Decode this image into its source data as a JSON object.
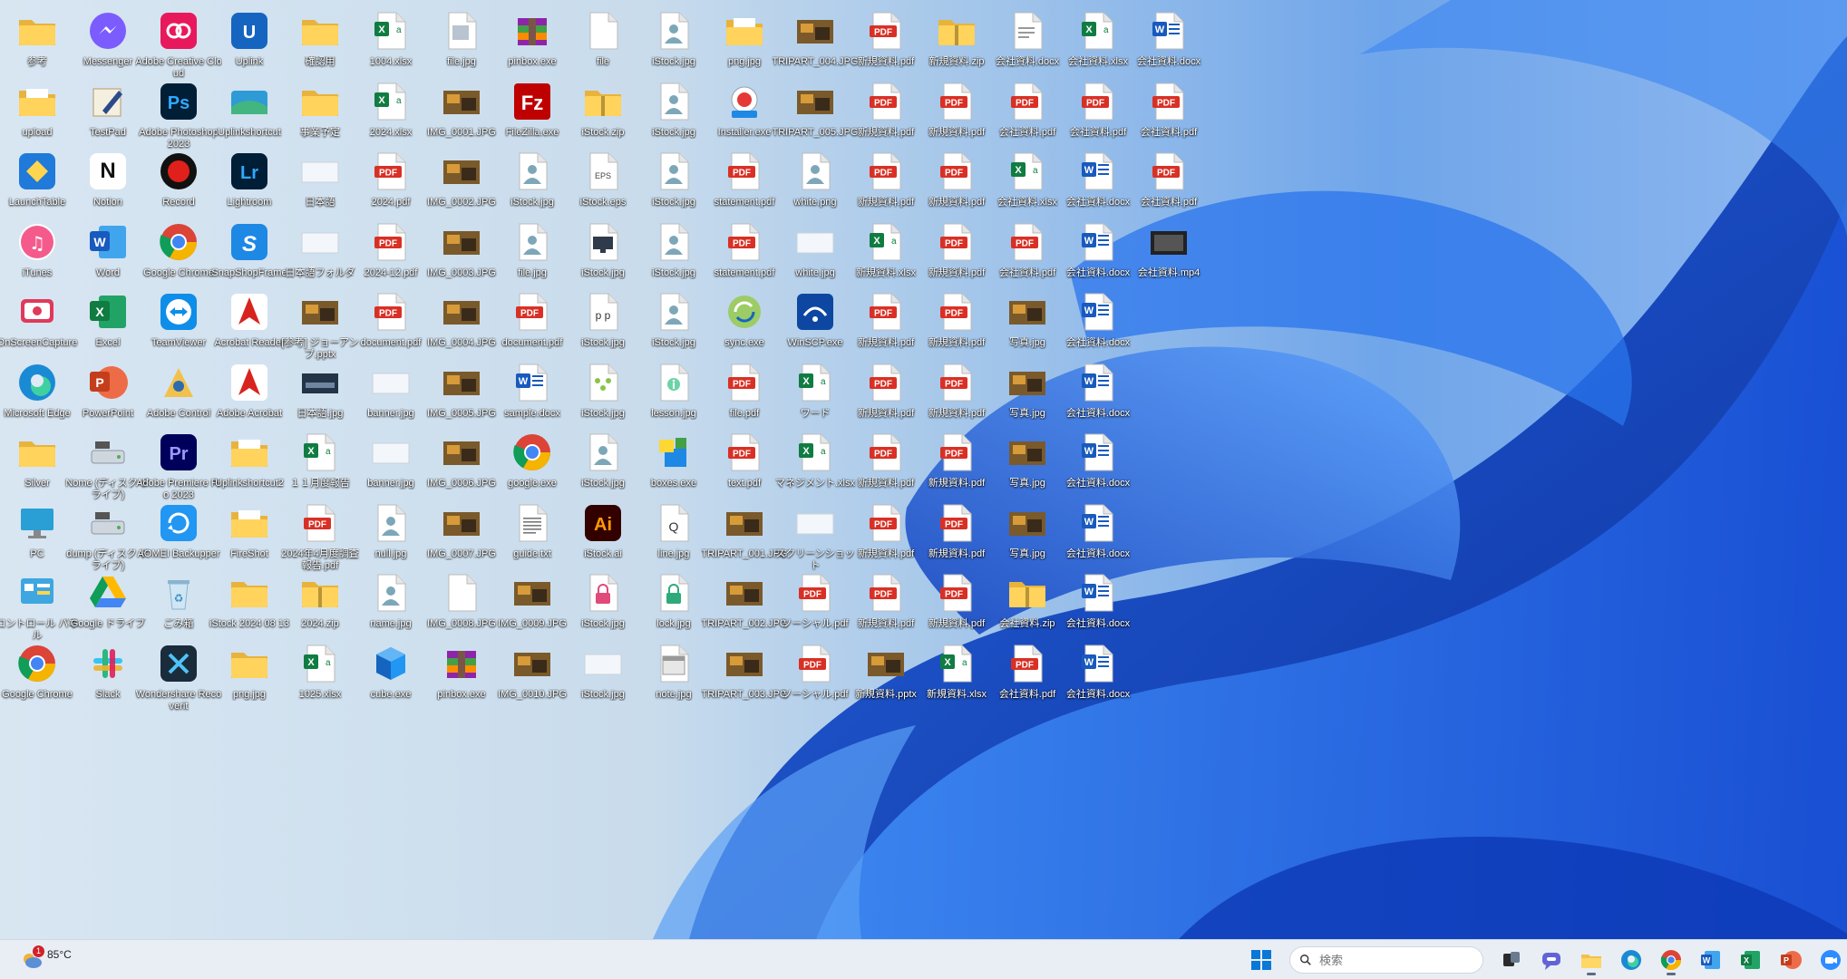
{
  "taskbar": {
    "weather": {
      "temp": "85°C",
      "condition": "",
      "badge": "1"
    },
    "search": {
      "placeholder": "検索",
      "value": ""
    },
    "apps": [
      {
        "name": "windows-start",
        "icon": "windows-icon"
      },
      {
        "name": "search-field",
        "icon": "search-icon"
      },
      {
        "name": "task-view",
        "icon": "task-view-icon"
      },
      {
        "name": "teams-chat",
        "icon": "chat-icon"
      },
      {
        "name": "file-explorer",
        "icon": "folder-icon",
        "running": true
      },
      {
        "name": "edge",
        "icon": "edge-icon"
      },
      {
        "name": "chrome",
        "icon": "chrome-icon",
        "running": true
      },
      {
        "name": "word",
        "icon": "word-icon"
      },
      {
        "name": "excel",
        "icon": "excel-icon"
      },
      {
        "name": "powerpoint",
        "icon": "powerpoint-icon"
      },
      {
        "name": "zoom",
        "icon": "zoom-icon"
      }
    ]
  },
  "desktop": {
    "columns": [
      [
        {
          "label": "参考",
          "icon": "folder"
        },
        {
          "label": "upload",
          "icon": "folder-doc"
        },
        {
          "label": "LaunchTable",
          "icon": "app-blue"
        },
        {
          "label": "iTunes",
          "icon": "itunes"
        },
        {
          "label": "OnScreenCapture",
          "icon": "app-red"
        },
        {
          "label": "Microsoft Edge",
          "icon": "edge"
        },
        {
          "label": "Silver",
          "icon": "folder"
        },
        {
          "label": "PC",
          "icon": "pc"
        },
        {
          "label": "コントロール パネル",
          "icon": "control-panel"
        },
        {
          "label": "Google Chrome",
          "icon": "chrome"
        }
      ],
      [
        {
          "label": "Messenger",
          "icon": "messenger"
        },
        {
          "label": "TestPad",
          "icon": "app-pen"
        },
        {
          "label": "Notion",
          "icon": "notion"
        },
        {
          "label": "Word",
          "icon": "word"
        },
        {
          "label": "Excel",
          "icon": "excel"
        },
        {
          "label": "PowerPoint",
          "icon": "powerpoint"
        },
        {
          "label": "Nome (ディスク ドライブ)",
          "icon": "drive"
        },
        {
          "label": "dump (ディスク ドライブ)",
          "icon": "drive"
        },
        {
          "label": "Google ドライブ",
          "icon": "gdrive"
        },
        {
          "label": "Slack",
          "icon": "slack"
        }
      ],
      [
        {
          "label": "Adobe Creative Cloud",
          "icon": "creative-cloud"
        },
        {
          "label": "Adobe Photoshop 2023",
          "icon": "photoshop"
        },
        {
          "label": "Record",
          "icon": "record"
        },
        {
          "label": "Google Chrome",
          "icon": "chrome"
        },
        {
          "label": "TeamViewer",
          "icon": "teamviewer"
        },
        {
          "label": "Adobe Control",
          "icon": "app-gold"
        },
        {
          "label": "Adobe Premiere Pro 2023",
          "icon": "premiere"
        },
        {
          "label": "AOMEI Backupper",
          "icon": "aomei"
        },
        {
          "label": "ごみ箱",
          "icon": "recycle"
        },
        {
          "label": "Wondershare Recoverit",
          "icon": "app-dark"
        }
      ],
      [
        {
          "label": "Uplink",
          "icon": "app-blue2"
        },
        {
          "label": "Uplinkshortcut",
          "icon": "app-green"
        },
        {
          "label": "Lightroom",
          "icon": "lightroom"
        },
        {
          "label": "SnapShopFrame",
          "icon": "app-s"
        },
        {
          "label": "Acrobat Reader",
          "icon": "acrobat"
        },
        {
          "label": "Adobe Acrobat",
          "icon": "acrobat"
        },
        {
          "label": "Uplinkshortcut2",
          "icon": "folder-doc"
        },
        {
          "label": "FireShot",
          "icon": "folder-doc"
        },
        {
          "label": "iStock 2024 08 13",
          "icon": "folder"
        },
        {
          "label": "png.jpg",
          "icon": "folder"
        }
      ],
      [
        {
          "label": "確認用",
          "icon": "folder"
        },
        {
          "label": "事業予定",
          "icon": "folder"
        },
        {
          "label": "日本語",
          "icon": "image-blank"
        },
        {
          "label": "日本語フォルダ",
          "icon": "image-blank"
        },
        {
          "label": "[参考] ジョーアンプ.pptx",
          "icon": "image-photo"
        },
        {
          "label": "日本語.jpg",
          "icon": "image-dark"
        },
        {
          "label": "１１月度報告",
          "icon": "excel-file"
        },
        {
          "label": "2024年4月度調査報告.pdf",
          "icon": "pdf"
        },
        {
          "label": "2024.zip",
          "icon": "zip"
        },
        {
          "label": "1025.xlsx",
          "icon": "excel-file"
        }
      ],
      [
        {
          "label": "1004.xlsx",
          "icon": "excel-file"
        },
        {
          "label": "2024.xlsx",
          "icon": "excel-file"
        },
        {
          "label": "2024.pdf",
          "icon": "pdf"
        },
        {
          "label": "2024-12.pdf",
          "icon": "pdf"
        },
        {
          "label": "document.pdf",
          "icon": "pdf"
        },
        {
          "label": "banner.jpg",
          "icon": "image-blank"
        },
        {
          "label": "banner.jpg",
          "icon": "image-blank"
        },
        {
          "label": "null.jpg",
          "icon": "person-file"
        },
        {
          "label": "name.jpg",
          "icon": "person-file"
        },
        {
          "label": "cube.exe",
          "icon": "cube"
        }
      ],
      [
        {
          "label": "file.jpg",
          "icon": "image-file"
        },
        {
          "label": "IMG_0001.JPG",
          "icon": "image-photo"
        },
        {
          "label": "IMG_0002.JPG",
          "icon": "image-photo"
        },
        {
          "label": "IMG_0003.JPG",
          "icon": "image-photo"
        },
        {
          "label": "IMG_0004.JPG",
          "icon": "image-photo"
        },
        {
          "label": "IMG_0005.JPG",
          "icon": "image-photo"
        },
        {
          "label": "IMG_0006.JPG",
          "icon": "image-photo"
        },
        {
          "label": "IMG_0007.JPG",
          "icon": "image-photo"
        },
        {
          "label": "IMG_0008.JPG",
          "icon": "generic-file"
        },
        {
          "label": "pinbox.exe",
          "icon": "winrar"
        }
      ],
      [
        {
          "label": "pinbox.exe",
          "icon": "winrar"
        },
        {
          "label": "FileZilla.exe",
          "icon": "filezilla"
        },
        {
          "label": "iStock.jpg",
          "icon": "person-file"
        },
        {
          "label": "file.jpg",
          "icon": "person-file"
        },
        {
          "label": "document.pdf",
          "icon": "pdf"
        },
        {
          "label": "sample.docx",
          "icon": "word-file"
        },
        {
          "label": "google.exe",
          "icon": "chrome"
        },
        {
          "label": "guide.txt",
          "icon": "text-file"
        },
        {
          "label": "IMG_0009.JPG",
          "icon": "image-photo"
        },
        {
          "label": "IMG_0010.JPG",
          "icon": "image-photo"
        }
      ],
      [
        {
          "label": "file",
          "icon": "generic-file"
        },
        {
          "label": "iStock.zip",
          "icon": "zip"
        },
        {
          "label": "iStock.eps",
          "icon": "eps"
        },
        {
          "label": "iStock.jpg",
          "icon": "monitor-file"
        },
        {
          "label": "iStock.jpg",
          "icon": "pp-file"
        },
        {
          "label": "iStock.jpg",
          "icon": "chart-file"
        },
        {
          "label": "iStock.jpg",
          "icon": "person-file"
        },
        {
          "label": "iStock.ai",
          "icon": "illustrator"
        },
        {
          "label": "iStock.jpg",
          "icon": "lock-pink"
        },
        {
          "label": "iStock.jpg",
          "icon": "image-blank"
        }
      ],
      [
        {
          "label": "iStock.jpg",
          "icon": "person-file"
        },
        {
          "label": "iStock.jpg",
          "icon": "person-file"
        },
        {
          "label": "iStock.jpg",
          "icon": "person-file"
        },
        {
          "label": "iStock.jpg",
          "icon": "person-file"
        },
        {
          "label": "iStock.jpg",
          "icon": "person-file"
        },
        {
          "label": "lesson.jpg",
          "icon": "info-file"
        },
        {
          "label": "boxes.exe",
          "icon": "boxes"
        },
        {
          "label": "line.jpg",
          "icon": "q-file"
        },
        {
          "label": "lock.jpg",
          "icon": "lock-green"
        },
        {
          "label": "note.jpg",
          "icon": "note-file"
        }
      ],
      [
        {
          "label": "png.jpg",
          "icon": "folder-doc"
        },
        {
          "label": "Installer.exe",
          "icon": "installer"
        },
        {
          "label": "statement.pdf",
          "icon": "pdf"
        },
        {
          "label": "statement.pdf",
          "icon": "pdf"
        },
        {
          "label": "sync.exe",
          "icon": "sync"
        },
        {
          "label": "file.pdf",
          "icon": "pdf"
        },
        {
          "label": "text.pdf",
          "icon": "pdf"
        },
        {
          "label": "TRIPART_001.JPG",
          "icon": "image-photo"
        },
        {
          "label": "TRIPART_002.JPG",
          "icon": "image-photo"
        },
        {
          "label": "TRIPART_003.JPG",
          "icon": "image-photo"
        }
      ],
      [
        {
          "label": "TRIPART_004.JPG",
          "icon": "image-photo"
        },
        {
          "label": "TRIPART_005.JPG",
          "icon": "image-photo"
        },
        {
          "label": "white.png",
          "icon": "person-file"
        },
        {
          "label": "white.jpg",
          "icon": "image-blank"
        },
        {
          "label": "WinSCP.exe",
          "icon": "winscp"
        },
        {
          "label": "ワード",
          "icon": "excel-file"
        },
        {
          "label": "マネジメント.xlsx",
          "icon": "excel-file"
        },
        {
          "label": "スクリーンショット",
          "icon": "image-blank"
        },
        {
          "label": "ソーシャル.pdf",
          "icon": "pdf"
        },
        {
          "label": "ソーシャル.pdf",
          "icon": "pdf"
        }
      ],
      [
        {
          "label": "新規資料.pdf",
          "icon": "pdf"
        },
        {
          "label": "新規資料.pdf",
          "icon": "pdf"
        },
        {
          "label": "新規資料.pdf",
          "icon": "pdf"
        },
        {
          "label": "新規資料.xlsx",
          "icon": "excel-file"
        },
        {
          "label": "新規資料.pdf",
          "icon": "pdf"
        },
        {
          "label": "新規資料.pdf",
          "icon": "pdf"
        },
        {
          "label": "新規資料.pdf",
          "icon": "pdf"
        },
        {
          "label": "新規資料.pdf",
          "icon": "pdf"
        },
        {
          "label": "新規資料.pdf",
          "icon": "pdf"
        },
        {
          "label": "新規資料.pptx",
          "icon": "image-photo"
        }
      ],
      [
        {
          "label": "新規資料.zip",
          "icon": "zip"
        },
        {
          "label": "新規資料.pdf",
          "icon": "pdf"
        },
        {
          "label": "新規資料.pdf",
          "icon": "pdf"
        },
        {
          "label": "新規資料.pdf",
          "icon": "pdf"
        },
        {
          "label": "新規資料.pdf",
          "icon": "pdf"
        },
        {
          "label": "新規資料.pdf",
          "icon": "pdf"
        },
        {
          "label": "新規資料.pdf",
          "icon": "pdf"
        },
        {
          "label": "新規資料.pdf",
          "icon": "pdf"
        },
        {
          "label": "新規資料.pdf",
          "icon": "pdf"
        },
        {
          "label": "新規資料.xlsx",
          "icon": "excel-file"
        }
      ],
      [
        {
          "label": "会社資料.docx",
          "icon": "doc-blank"
        },
        {
          "label": "会社資料.pdf",
          "icon": "pdf"
        },
        {
          "label": "会社資料.xlsx",
          "icon": "excel-file"
        },
        {
          "label": "会社資料.pdf",
          "icon": "pdf"
        },
        {
          "label": "写真.jpg",
          "icon": "image-photo"
        },
        {
          "label": "写真.jpg",
          "icon": "image-photo"
        },
        {
          "label": "写真.jpg",
          "icon": "image-photo"
        },
        {
          "label": "写真.jpg",
          "icon": "image-photo"
        },
        {
          "label": "会社資料.zip",
          "icon": "zip"
        },
        {
          "label": "会社資料.pdf",
          "icon": "pdf"
        }
      ],
      [
        {
          "label": "会社資料.xlsx",
          "icon": "excel-file"
        },
        {
          "label": "会社資料.pdf",
          "icon": "pdf"
        },
        {
          "label": "会社資料.docx",
          "icon": "word-file"
        },
        {
          "label": "会社資料.docx",
          "icon": "word-file"
        },
        {
          "label": "会社資料.docx",
          "icon": "word-file"
        },
        {
          "label": "会社資料.docx",
          "icon": "word-file"
        },
        {
          "label": "会社資料.docx",
          "icon": "word-file"
        },
        {
          "label": "会社資料.docx",
          "icon": "word-file"
        },
        {
          "label": "会社資料.docx",
          "icon": "word-file"
        },
        {
          "label": "会社資料.docx",
          "icon": "word-file"
        }
      ],
      [
        {
          "label": "会社資料.docx",
          "icon": "word-file"
        },
        {
          "label": "会社資料.pdf",
          "icon": "pdf"
        },
        {
          "label": "会社資料.pdf",
          "icon": "pdf"
        },
        {
          "label": "会社資料.mp4",
          "icon": "video-file"
        }
      ]
    ]
  }
}
